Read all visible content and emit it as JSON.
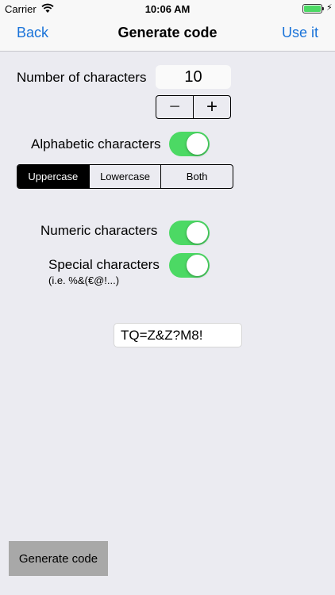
{
  "status_bar": {
    "carrier": "Carrier",
    "time": "10:06 AM",
    "battery_level": 1.0
  },
  "nav": {
    "back_label": "Back",
    "title": "Generate code",
    "action_label": "Use it"
  },
  "length": {
    "label": "Number of characters",
    "value": "10",
    "minus_symbol": "−",
    "plus_symbol": "+"
  },
  "alphabetic": {
    "label": "Alphabetic characters",
    "enabled": true,
    "case_options": [
      "Uppercase",
      "Lowercase",
      "Both"
    ],
    "selected_case": "Uppercase"
  },
  "numeric": {
    "label": "Numeric characters",
    "enabled": true
  },
  "special": {
    "label": "Special characters",
    "hint": "(i.e. %&(€@!...)",
    "enabled": true
  },
  "result": {
    "code": "TQ=Z&Z?M8!"
  },
  "generate_button_label": "Generate code",
  "colors": {
    "accent": "#1a73d9",
    "toggle_on": "#4cd964",
    "background": "#ebebf1"
  }
}
